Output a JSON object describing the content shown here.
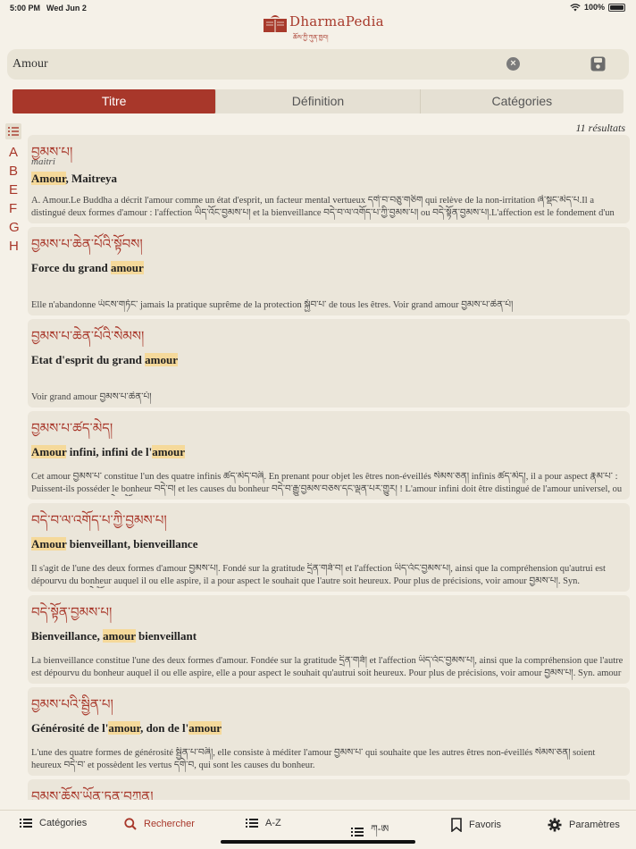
{
  "status": {
    "time": "5:00 PM",
    "date": "Wed Jun 2",
    "battery": "100%"
  },
  "app": {
    "title": "DharmaPedia",
    "subtitle_tibetan": "ཆོས་ཀྱི་ཀུན་ཁྱབ།"
  },
  "search": {
    "value": "Amour",
    "placeholder": ""
  },
  "tabs": [
    {
      "label": "Titre",
      "active": true
    },
    {
      "label": "Définition",
      "active": false
    },
    {
      "label": "Catégories",
      "active": false
    }
  ],
  "results_count": "11 résultats",
  "alphabet": [
    "A",
    "B",
    "E",
    "F",
    "G",
    "H"
  ],
  "results": [
    {
      "tibetan": "བྱམས་པ།",
      "translit": "maitri",
      "title": [
        {
          "t": "Amour",
          "hl": true
        },
        {
          "t": ", Maitreya",
          "hl": false
        }
      ],
      "desc": "A. Amour.Le Buddha a décrit l'amour comme un état d'esprit, un facteur mental vertueux དགེ་བ་བཅུ་གཅིག qui relève de la non-irritation ཞེ་སྡང་མེད་པ.Il a distingué deux formes d'amour : l'affection ཡིད་འོང་བྱམས་པ། et la bienveillance བདེ་བ་ལ་འགོད་པ་ཀྱི་བྱམས་པ། ou བདེ་སྟོན་བྱམས་པ།.L'affection est le fondement d'un authentique intérêt pour autrui…"
    },
    {
      "tibetan": "བྱམས་པ་ཆེན་པོའི་སྟོབས།",
      "translit": "",
      "title": [
        {
          "t": "Force du grand ",
          "hl": false
        },
        {
          "t": "amour",
          "hl": true
        }
      ],
      "desc": "Elle n'abandonne ཡོངས་གཏོང་ jamais la pratique suprême de la protection སྐྱོབ་པ་ de tous les êtres. Voir grand amour བྱམས་པ་ཆེན་པོ།"
    },
    {
      "tibetan": "བྱམས་པ་ཆེན་པོའི་སེམས།",
      "translit": "",
      "title": [
        {
          "t": "Etat d'esprit du grand ",
          "hl": false
        },
        {
          "t": "amour",
          "hl": true
        }
      ],
      "desc": "Voir grand amour བྱམས་པ་ཆེན་པོ།"
    },
    {
      "tibetan": "བྱམས་པ་ཚད་མེད།",
      "translit": "",
      "title": [
        {
          "t": "Amour",
          "hl": true
        },
        {
          "t": " infini, infini de l'",
          "hl": false
        },
        {
          "t": "amour",
          "hl": true
        }
      ],
      "desc": "Cet amour བྱམས་པ་ constitue l'un des quatre infinis ཚད་མེད་བཞི. En prenant pour objet les êtres non-éveillés སེམས་ཅན། infinis ཚད་མེད།, il a pour aspect རྣམ་པ་ : Puissent-ils posséder le bonheur བདེ་བ། et les causes du bonheur བདེ་བ་རྒྱུ་བྱམས་བཅས་དང་ལྡན་པར་གྱུར། ! L'amour infini doit être distingué de l'amour universel, ou grand amour བྱམས་པ་ཆེན་པོ།,…"
    },
    {
      "tibetan": "བདེ་བ་ལ་འགོད་པ་ཀྱི་བྱམས་པ།",
      "translit": "",
      "title": [
        {
          "t": "Amour",
          "hl": true
        },
        {
          "t": " bienveillant, bienveillance",
          "hl": false
        }
      ],
      "desc": "Il s'agit de l'une des deux formes d'amour བྱམས་པ།. Fondé sur la gratitude དྲིན་གཟོ་བ། et l'affection ཡིད་འོང་བྱམས་པ།, ainsi que la compréhension qu'autrui est dépourvu du bonheur auquel il ou elle aspire, il a pour aspect le souhait que l'autre soit heureux. Pour plus de précisions, voir amour བྱམས་པ།. Syn. bienveillance བདེ་སྟོན་བྱམས་པ།"
    },
    {
      "tibetan": "བདེ་སྟོན་བྱམས་པ།",
      "translit": "",
      "title": [
        {
          "t": "Bienveillance, ",
          "hl": false
        },
        {
          "t": "amour",
          "hl": true
        },
        {
          "t": " bienveillant",
          "hl": false
        }
      ],
      "desc": "La bienveillance constitue l'une des deux formes d'amour. Fondée sur la gratitude དྲིན་གཟོ། et l'affection ཡིད་འོང་བྱམས་པ།, ainsi que la compréhension que l'autre est dépourvu du bonheur auquel il ou elle aspire, elle a pour aspect le souhait qu'autrui soit heureux. Pour plus de précisions, voir amour བྱམས་པ།. Syn. amour bienveil…"
    },
    {
      "tibetan": "བྱམས་པའི་སྦྱིན་པ།",
      "translit": "",
      "title": [
        {
          "t": "Générosité de l'",
          "hl": false
        },
        {
          "t": "amour",
          "hl": true
        },
        {
          "t": ", don de l'",
          "hl": false
        },
        {
          "t": "amour",
          "hl": true
        }
      ],
      "desc": "L'une des quatre formes de générosité སྦྱིན་པ་བཞི།, elle consiste à méditer l'amour བྱམས་པ་ qui souhaite que les autres êtres non-éveillés སེམས་ཅན། soient heureux བདེ་བ་ et possèdent les vertus དགེ་བ, qui sont les causes du bonheur."
    },
    {
      "tibetan": "བྱམས་ཆོས་ཡོན་ཏན་བཀྲུན།",
      "translit": "",
      "title": [],
      "desc": ""
    }
  ],
  "bottom_tabs": [
    {
      "label": "Catégories",
      "icon": "list-icon",
      "active": false
    },
    {
      "label": "Rechercher",
      "icon": "search-icon",
      "active": true
    },
    {
      "label": "A-Z",
      "icon": "list-icon",
      "active": false
    },
    {
      "label": "ཀ-ཨ",
      "icon": "list-icon",
      "active": false
    },
    {
      "label": "Favoris",
      "icon": "bookmark-icon",
      "active": false
    },
    {
      "label": "Paramètres",
      "icon": "gear-icon",
      "active": false
    }
  ],
  "colors": {
    "accent": "#a8372a",
    "highlight": "#f5d99a",
    "card": "#ebe6da",
    "background": "#f5f1e8"
  }
}
